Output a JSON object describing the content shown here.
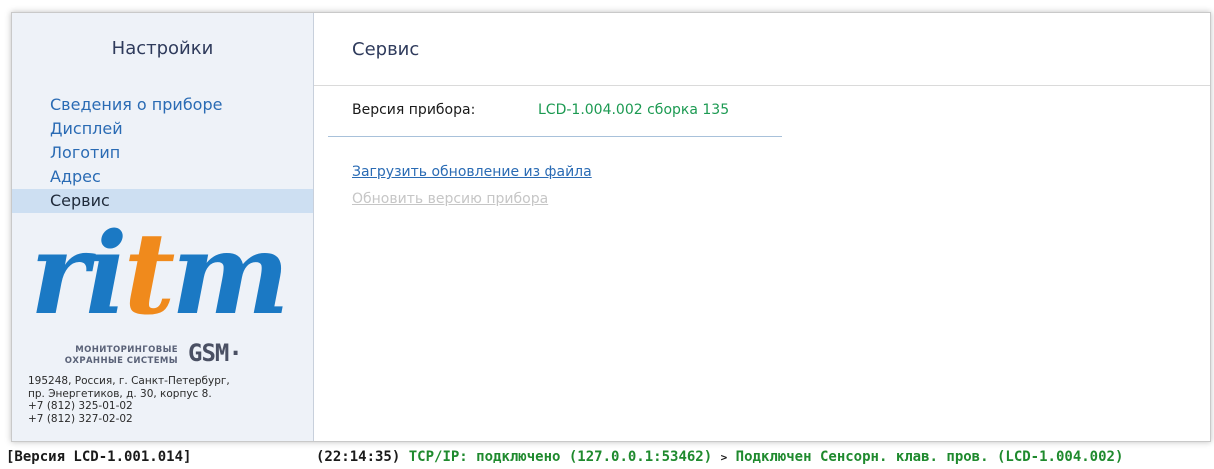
{
  "sidebar": {
    "title": "Настройки",
    "items": [
      {
        "label": "Сведения о приборе",
        "active": false
      },
      {
        "label": "Дисплей",
        "active": false
      },
      {
        "label": "Логотип",
        "active": false
      },
      {
        "label": "Адрес",
        "active": false
      },
      {
        "label": "Сервис",
        "active": true
      }
    ],
    "logo": {
      "word_part1": "ri",
      "word_part2": "t",
      "word_part3": "m",
      "subtitle_line1": "МОНИТОРИНГОВЫЕ",
      "subtitle_line2": "ОХРАННЫЕ СИСТЕМЫ",
      "gsm": "GSM·",
      "colors": {
        "blue": "#1b79c4",
        "orange": "#f08a1c"
      }
    },
    "address": [
      "195248, Россия, г. Санкт-Петербург,",
      "пр. Энергетиков, д. 30, корпус 8.",
      "+7 (812) 325-01-02",
      "+7 (812) 327-02-02"
    ]
  },
  "main": {
    "title": "Сервис",
    "version_label": "Версия прибора:",
    "version_value": "LCD-1.004.002 сборка 135",
    "upload_link": "Загрузить обновление из файла",
    "update_link": "Обновить версию прибора"
  },
  "statusbar": {
    "app_version": "[Версия LCD-1.001.014]",
    "time": "(22:14:35)",
    "connection": "TCP/IP: подключено (127.0.0.1:53462)",
    "separator": ">",
    "device": "Подключен Сенсорн. клав. пров. (LCD-1.004.002)"
  }
}
